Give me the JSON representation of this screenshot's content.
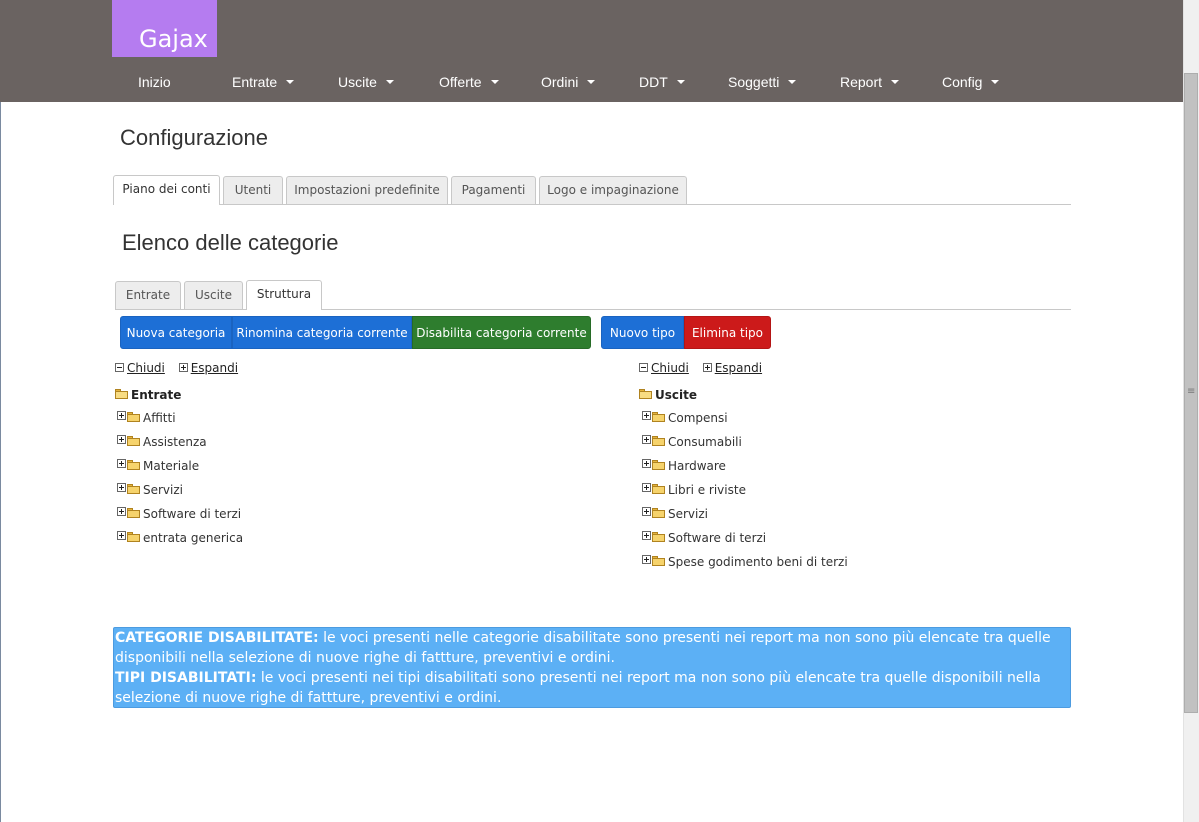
{
  "app": {
    "logo": "Gajax"
  },
  "nav": [
    {
      "label": "Inizio",
      "dropdown": false
    },
    {
      "label": "Entrate",
      "dropdown": true
    },
    {
      "label": "Uscite",
      "dropdown": true
    },
    {
      "label": "Offerte",
      "dropdown": true
    },
    {
      "label": "Ordini",
      "dropdown": true
    },
    {
      "label": "DDT",
      "dropdown": true
    },
    {
      "label": "Soggetti",
      "dropdown": true
    },
    {
      "label": "Report",
      "dropdown": true
    },
    {
      "label": "Config",
      "dropdown": true
    }
  ],
  "page": {
    "title": "Configurazione"
  },
  "main_tabs": [
    {
      "label": "Piano dei conti",
      "active": true
    },
    {
      "label": "Utenti",
      "active": false
    },
    {
      "label": "Impostazioni predefinite",
      "active": false
    },
    {
      "label": "Pagamenti",
      "active": false
    },
    {
      "label": "Logo e impaginazione",
      "active": false
    }
  ],
  "section": {
    "title": "Elenco delle categorie"
  },
  "sub_tabs": [
    {
      "label": "Entrate",
      "active": false
    },
    {
      "label": "Uscite",
      "active": false
    },
    {
      "label": "Struttura",
      "active": true
    }
  ],
  "buttons": {
    "new_category": "Nuova categoria",
    "rename_category": "Rinomina categoria corrente",
    "disable_category": "Disabilita categoria corrente",
    "new_type": "Nuovo tipo",
    "delete_type": "Elimina tipo"
  },
  "tree_controls": {
    "collapse": "Chiudi",
    "expand": "Espandi"
  },
  "tree_left": {
    "root": "Entrate",
    "items": [
      "Affitti",
      "Assistenza",
      "Materiale",
      "Servizi",
      "Software di terzi",
      "entrata generica"
    ]
  },
  "tree_right": {
    "root": "Uscite",
    "items": [
      "Compensi",
      "Consumabili",
      "Hardware",
      "Libri e riviste",
      "Servizi",
      "Software di terzi",
      "Spese godimento beni di terzi"
    ]
  },
  "info": {
    "cat_label": "CATEGORIE DISABILITATE:",
    "cat_text": " le voci presenti nelle categorie disabilitate sono presenti nei report ma non sono più elencate tra quelle disponibili nella selezione di nuove righe di fattture, preventivi e ordini.",
    "tipi_label": "TIPI DISABILITATI:",
    "tipi_text": " le voci presenti nei tipi disabilitati sono presenti nei report ma non sono più elencate tra quelle disponibili nella selezione di nuove righe di fattture, preventivi e ordini."
  },
  "colors": {
    "header_bg": "#6a6361",
    "logo_bg": "#b57cf0",
    "btn_blue": "#1d6fd6",
    "btn_green": "#2e7d2e",
    "btn_red": "#cc1a1a",
    "info_bg": "#5cb0f5"
  }
}
